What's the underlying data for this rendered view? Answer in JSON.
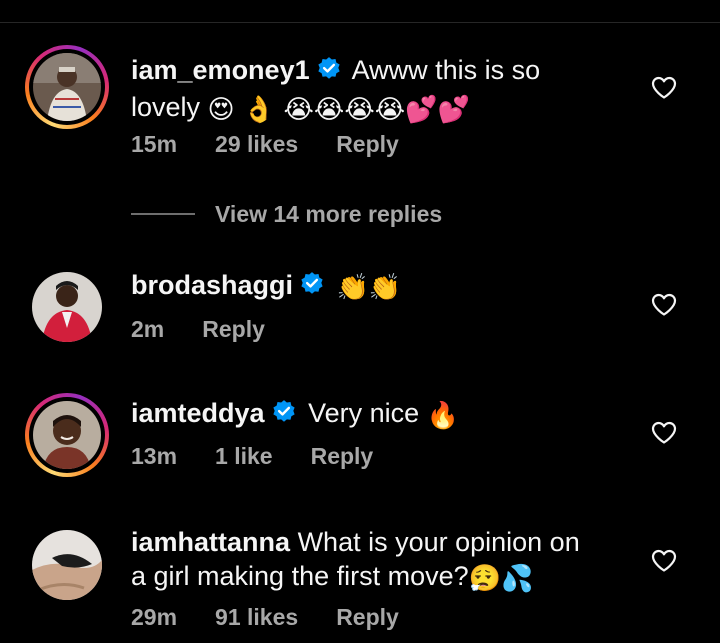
{
  "comments": [
    {
      "username": "iam_emoney1",
      "verified": true,
      "text": "Awww this is so lovely",
      "emojis": "😍 👌 😭😭😭😭💕💕",
      "time": "15m",
      "likes": "29 likes",
      "reply": "Reply"
    },
    {
      "username": "brodashaggi",
      "verified": true,
      "text": "",
      "emojis": "👏👏",
      "time": "2m",
      "likes": "",
      "reply": "Reply"
    },
    {
      "username": "iamteddya",
      "verified": true,
      "text": "Very nice",
      "emojis": "🔥",
      "time": "13m",
      "likes": "1 like",
      "reply": "Reply"
    },
    {
      "username": "iamhattanna",
      "verified": false,
      "text": "What is your opinion on a girl making the first move?",
      "emojis": "😮‍💨💦",
      "time": "29m",
      "likes": "91 likes",
      "reply": "Reply"
    }
  ],
  "view_more": "View 14 more replies",
  "colors": {
    "background": "#000000",
    "text": "#f5f5f5",
    "secondary": "#a8a8a8",
    "verified_badge": "#0095f6"
  }
}
